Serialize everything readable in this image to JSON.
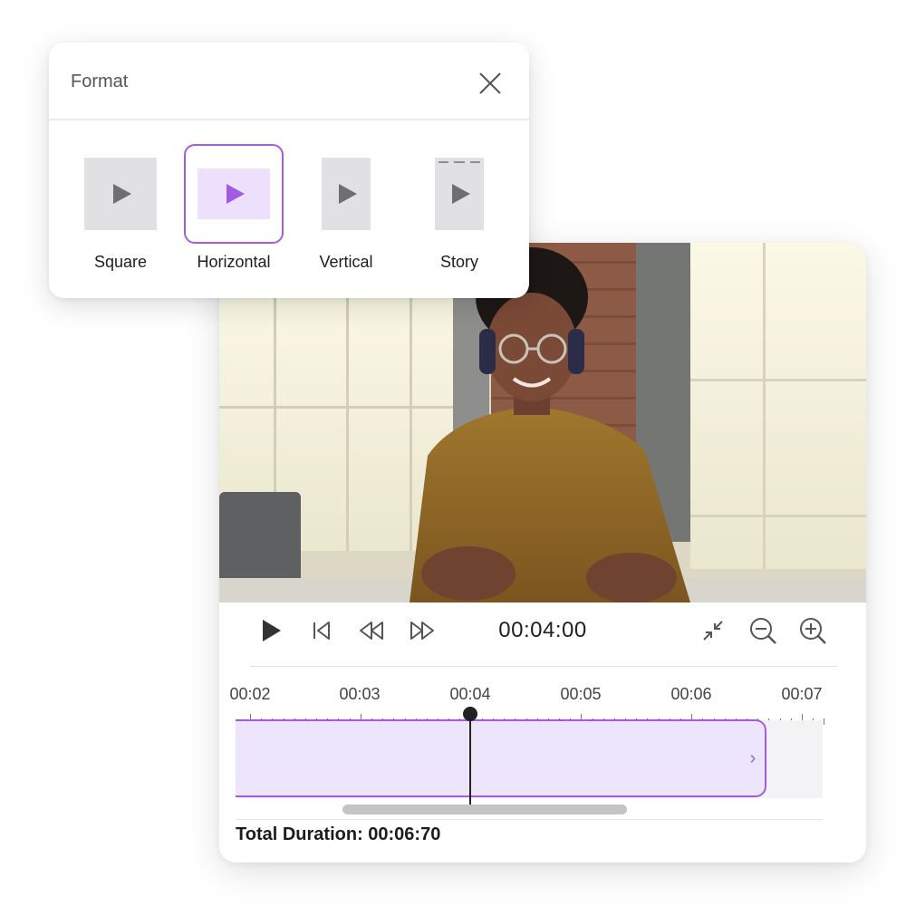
{
  "format_panel": {
    "title": "Format",
    "options": [
      {
        "label": "Square",
        "selected": false
      },
      {
        "label": "Horizontal",
        "selected": true
      },
      {
        "label": "Vertical",
        "selected": false
      },
      {
        "label": "Story",
        "selected": false
      }
    ]
  },
  "player": {
    "current_time": "00:04:00",
    "icons": [
      "play-icon",
      "skip-to-start-icon",
      "rewind-icon",
      "fast-forward-icon",
      "collapse-icon",
      "zoom-out-icon",
      "zoom-in-icon"
    ]
  },
  "timeline": {
    "tick_labels": [
      "00:02",
      "00:03",
      "00:04",
      "00:05",
      "00:06",
      "00:07"
    ],
    "total_duration": "Total Duration: 00:06:70"
  },
  "colors": {
    "accent": "#a25ce3",
    "clip_fill": "#ece5fb",
    "tile_gray": "#e1e1e4"
  }
}
